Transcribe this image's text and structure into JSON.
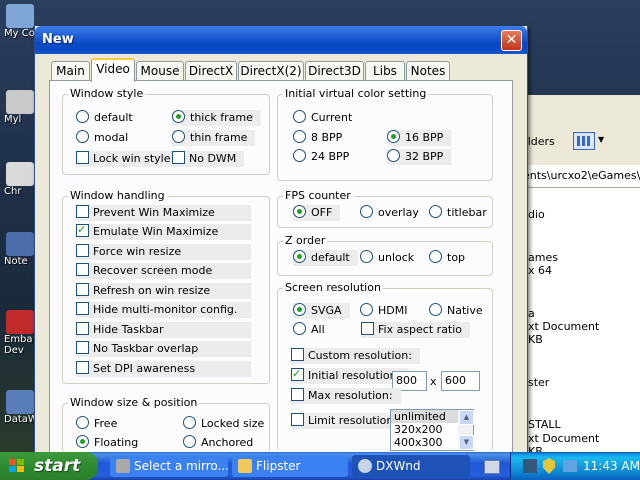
{
  "desktop": {
    "icons": [
      {
        "label": "My Co"
      },
      {
        "label": "Myl"
      },
      {
        "label": "Chr"
      },
      {
        "label": "Note"
      },
      {
        "label": "Emba"
      },
      {
        "label": "Dev"
      },
      {
        "label": "DataW"
      }
    ]
  },
  "explorer": {
    "folders_label": "olders",
    "address": "ents\\urcxo2\\eGames\\Fli",
    "items": [
      "dio",
      "ames",
      "x 64",
      "a",
      "xt Document",
      "KB",
      "ster",
      "STALL",
      "xt Document",
      "KB"
    ]
  },
  "dialog": {
    "title": "New",
    "close_glyph": "✕",
    "tabs": [
      "Main",
      "Video",
      "Mouse",
      "DirectX",
      "DirectX(2)",
      "Direct3D",
      "Libs",
      "Notes"
    ],
    "active_tab": "Video",
    "window_style": {
      "label": "Window style",
      "default": "default",
      "thick_frame": "thick frame",
      "modal": "modal",
      "thin_frame": "thin frame",
      "lock_win_style": "Lock win style",
      "no_dwm": "No DWM"
    },
    "color_setting": {
      "label": "Initial virtual color setting",
      "current": "Current",
      "bpp8": "8 BPP",
      "bpp16": "16 BPP",
      "bpp24": "24 BPP",
      "bpp32": "32 BPP"
    },
    "window_handling": {
      "label": "Window handling",
      "items": [
        "Prevent Win Maximize",
        "Emulate Win Maximize",
        "Force win resize",
        "Recover screen mode",
        "Refresh on win resize",
        "Hide multi-monitor config.",
        "Hide Taskbar",
        "No Taskbar overlap",
        "Set DPI awareness"
      ]
    },
    "fps_counter": {
      "label": "FPS counter",
      "off": "OFF",
      "overlay": "overlay",
      "titlebar": "titlebar"
    },
    "z_order": {
      "label": "Z order",
      "default": "default",
      "unlock": "unlock",
      "top": "top"
    },
    "screen_resolution": {
      "label": "Screen resolution",
      "svga": "SVGA",
      "hdmi": "HDMI",
      "native": "Native",
      "all": "All",
      "fix_aspect": "Fix aspect ratio",
      "custom_resolution": "Custom resolution:",
      "initial_resolution": "Initial resolution:",
      "width": "800",
      "times": "x",
      "height": "600",
      "max_resolution": "Max resolution:",
      "limit_resolution": "Limit  resolution:",
      "list": [
        "unlimited",
        "320x200",
        "400x300"
      ]
    },
    "window_size": {
      "label": "Window size & position",
      "free": "Free",
      "locked_size": "Locked size",
      "floating": "Floating",
      "anchored": "Anchored"
    }
  },
  "taskbar": {
    "start": "start",
    "tasks": [
      "Select a mirro...",
      "Flipster",
      "DXWnd"
    ],
    "clock": "11:43 AM"
  }
}
